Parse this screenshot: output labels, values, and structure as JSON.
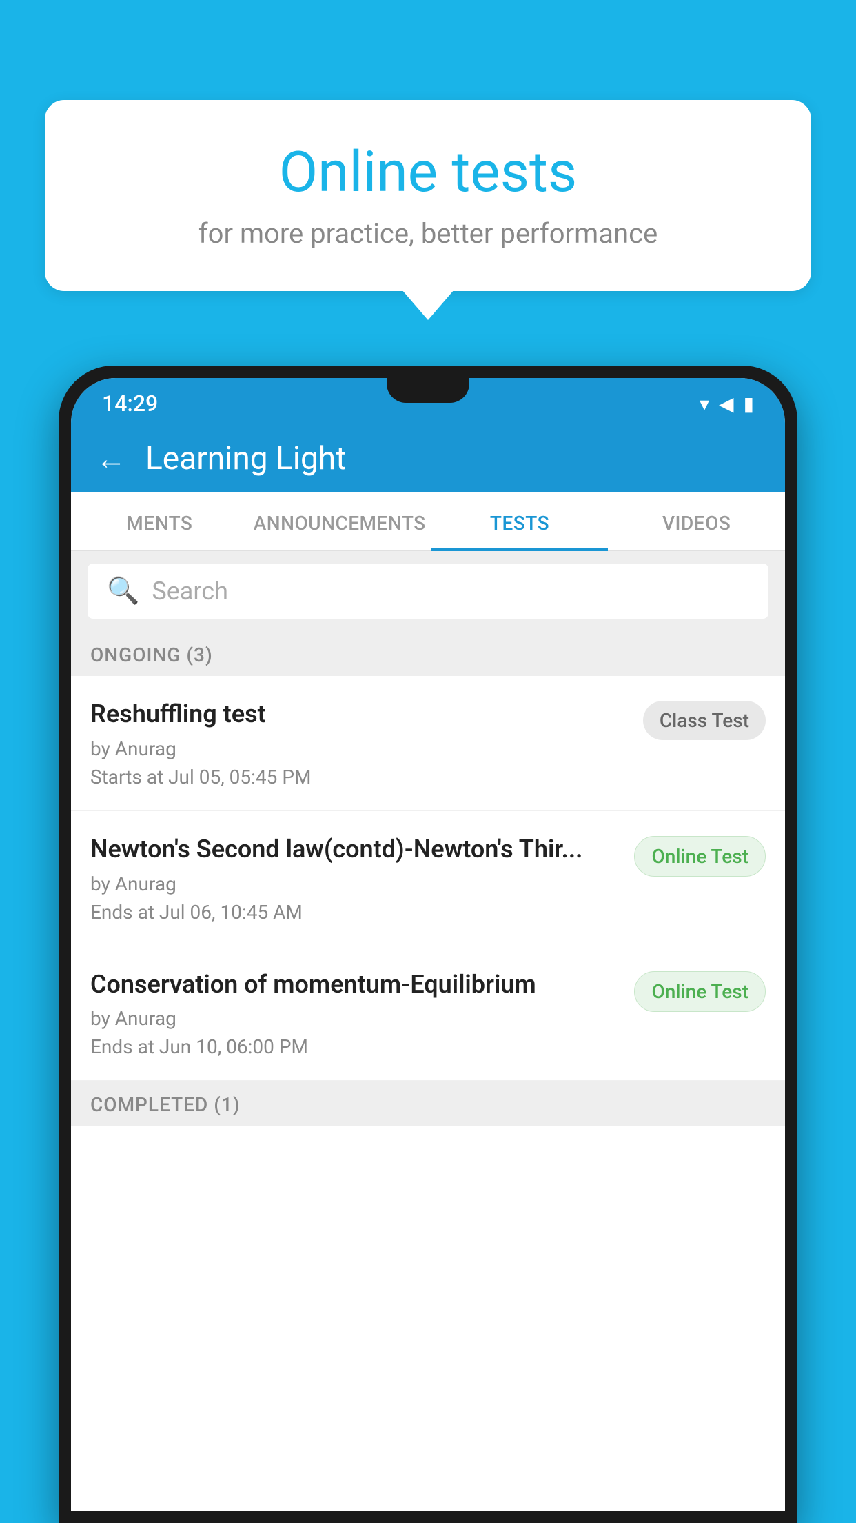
{
  "background_color": "#1ab4e8",
  "bubble": {
    "title": "Online tests",
    "subtitle": "for more practice, better performance"
  },
  "status_bar": {
    "time": "14:29",
    "icons": [
      "wifi",
      "signal",
      "battery"
    ]
  },
  "app_header": {
    "back_label": "←",
    "title": "Learning Light"
  },
  "tabs": [
    {
      "label": "MENTS",
      "active": false
    },
    {
      "label": "ANNOUNCEMENTS",
      "active": false
    },
    {
      "label": "TESTS",
      "active": true
    },
    {
      "label": "VIDEOS",
      "active": false
    }
  ],
  "search": {
    "placeholder": "Search"
  },
  "ongoing_section": {
    "label": "ONGOING (3)"
  },
  "tests": [
    {
      "name": "Reshuffling test",
      "author": "by Anurag",
      "time_label": "Starts at",
      "time": "Jul 05, 05:45 PM",
      "badge": "Class Test",
      "badge_type": "class"
    },
    {
      "name": "Newton's Second law(contd)-Newton's Thir...",
      "author": "by Anurag",
      "time_label": "Ends at",
      "time": "Jul 06, 10:45 AM",
      "badge": "Online Test",
      "badge_type": "online"
    },
    {
      "name": "Conservation of momentum-Equilibrium",
      "author": "by Anurag",
      "time_label": "Ends at",
      "time": "Jun 10, 06:00 PM",
      "badge": "Online Test",
      "badge_type": "online"
    }
  ],
  "completed_section": {
    "label": "COMPLETED (1)"
  }
}
